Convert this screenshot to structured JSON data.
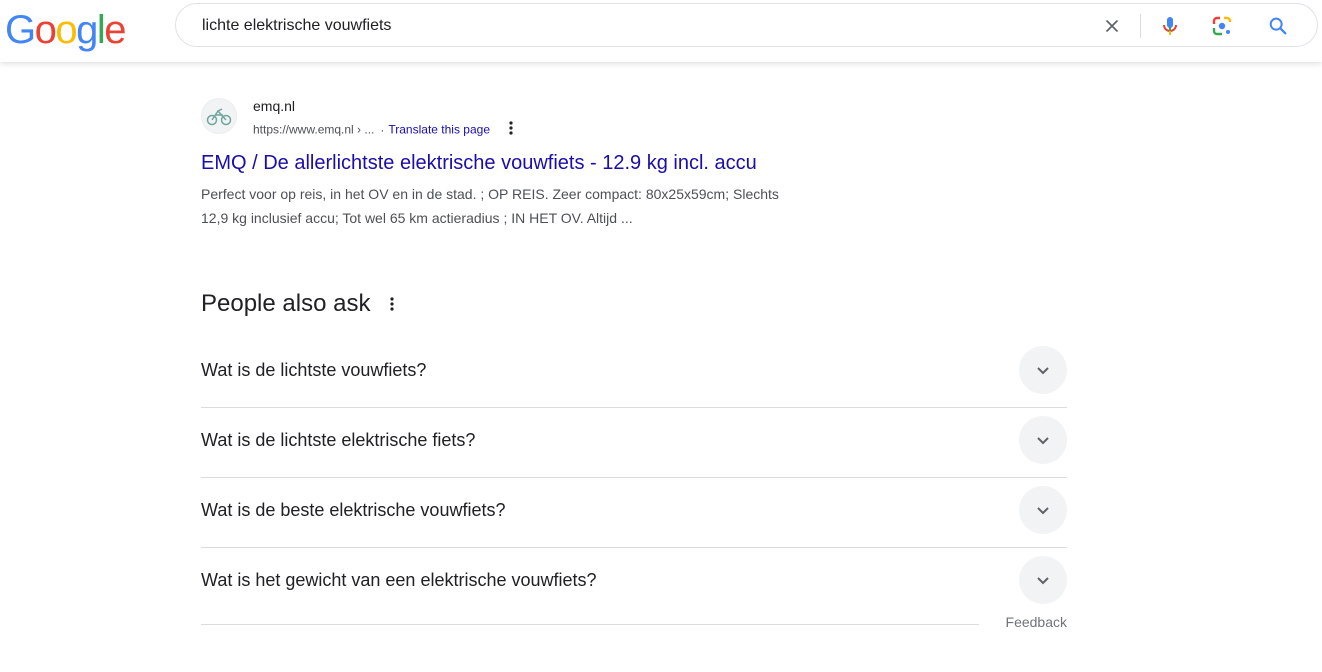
{
  "header": {
    "logo": [
      "G",
      "o",
      "o",
      "g",
      "l",
      "e"
    ],
    "logo_colors": [
      "#4285F4",
      "#EA4335",
      "#FBBC05",
      "#4285F4",
      "#34A853",
      "#EA4335"
    ],
    "search_query": "lichte elektrische vouwfiets",
    "icons": {
      "clear": "close-icon",
      "voice": "microphone-icon",
      "lens": "google-lens-icon",
      "search": "search-icon"
    }
  },
  "result": {
    "site_name": "emq.nl",
    "url": "https://www.emq.nl › ...",
    "separator": "·",
    "translate": "Translate this page",
    "title": "EMQ / De allerlichtste elektrische vouwfiets - 12.9 kg incl. accu",
    "snippet_line1": "Perfect voor op reis, in het OV en in de stad. ; OP REIS. Zeer compact: 80x25x59cm; Slechts",
    "snippet_line2": "12,9 kg inclusief accu; Tot wel 65 km actieradius ; IN HET OV. Altijd ..."
  },
  "paa": {
    "title": "People also ask",
    "questions": [
      "Wat is de lichtste vouwfiets?",
      "Wat is de lichtste elektrische fiets?",
      "Wat is de beste elektrische vouwfiets?",
      "Wat is het gewicht van een elektrische vouwfiets?"
    ],
    "feedback": "Feedback"
  },
  "colors": {
    "link": "#1a0dab",
    "text": "#202124",
    "secondary": "#4d5156",
    "divider": "#dadce0"
  }
}
